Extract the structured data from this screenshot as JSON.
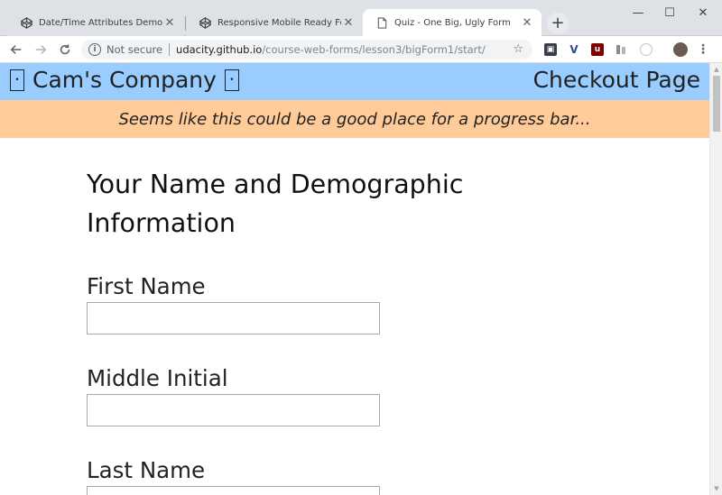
{
  "browser": {
    "tabs": [
      {
        "title": "Date/Time Attributes Demo",
        "icon": "codepen-icon",
        "active": false
      },
      {
        "title": "Responsive Mobile Ready Forms",
        "icon": "codepen-icon",
        "active": false
      },
      {
        "title": "Quiz - One Big, Ugly Form",
        "icon": "page-icon",
        "active": true
      }
    ],
    "new_tab_symbol": "+",
    "window_controls": {
      "minimize": "—",
      "maximize": "☐",
      "close": "✕"
    },
    "security_label": "Not secure",
    "url_host": "udacity.github.io",
    "url_path": "/course-web-forms/lesson3/bigForm1/start/"
  },
  "header": {
    "company_name": "Cam's Company",
    "page_label": "Checkout Page",
    "background": "#99ccff"
  },
  "banner": {
    "text": "Seems like this could be a good place for a progress bar...",
    "background": "#ffcc99"
  },
  "form": {
    "section_title": "Your Name and Demographic Information",
    "fields": [
      {
        "label": "First Name",
        "value": ""
      },
      {
        "label": "Middle Initial",
        "value": ""
      },
      {
        "label": "Last Name",
        "value": ""
      }
    ]
  }
}
